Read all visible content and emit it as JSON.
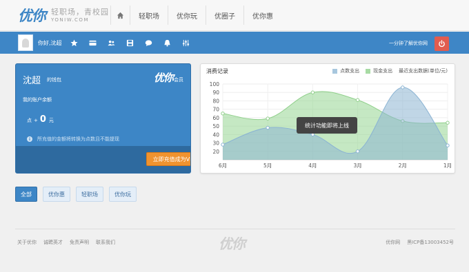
{
  "brand": {
    "logo": "优你",
    "slogan": "轻职场，青校园",
    "domain": "YONIW.COM"
  },
  "nav": {
    "items": [
      "轻职场",
      "优你玩",
      "优圈子",
      "优你惠"
    ]
  },
  "userbar": {
    "greeting": "你好,沈超",
    "about": "一分钟了解优你网"
  },
  "wallet": {
    "name": "沈超",
    "subtitle": "的钱包",
    "logo": "优你",
    "logo_sub": "会员",
    "label": "我的账户余额",
    "amount_prefix": "点",
    "amount_sep": "+",
    "amount": "0",
    "unit": "元",
    "note": "所充值的金额将转换为点数且不能提现",
    "vip_button": "立即充值成为VIP"
  },
  "records": {
    "title": "消费记录",
    "legend": [
      "点数支出",
      "现金支出",
      "最近支出数据(单位/元)"
    ],
    "tooltip": "统计功能即将上线"
  },
  "colors": {
    "accent": "#3d86c6",
    "points_series": "#a8c7de",
    "cash_series": "#a8dba4",
    "danger": "#e25c4f",
    "orange": "#f0932f"
  },
  "chart_data": {
    "type": "area",
    "categories": [
      "6月",
      "5月",
      "4月",
      "3月",
      "2月",
      "1月"
    ],
    "ylim": [
      10,
      100
    ],
    "yticks": [
      100,
      90,
      80,
      70,
      60,
      50,
      40,
      30,
      20
    ],
    "series": [
      {
        "name": "点数支出",
        "values": [
          28,
          48,
          40,
          20,
          96,
          27
        ]
      },
      {
        "name": "现金支出",
        "values": [
          65,
          59,
          90,
          81,
          56,
          54
        ]
      }
    ]
  },
  "filters": [
    "全部",
    "优你惠",
    "轻职场",
    "优你玩"
  ],
  "footer": {
    "links": [
      "关于优你",
      "诚聘英才",
      "免责声明",
      "联系我们"
    ],
    "logo": "优你",
    "site": "优你网",
    "icp": "黑ICP备13003452号"
  }
}
